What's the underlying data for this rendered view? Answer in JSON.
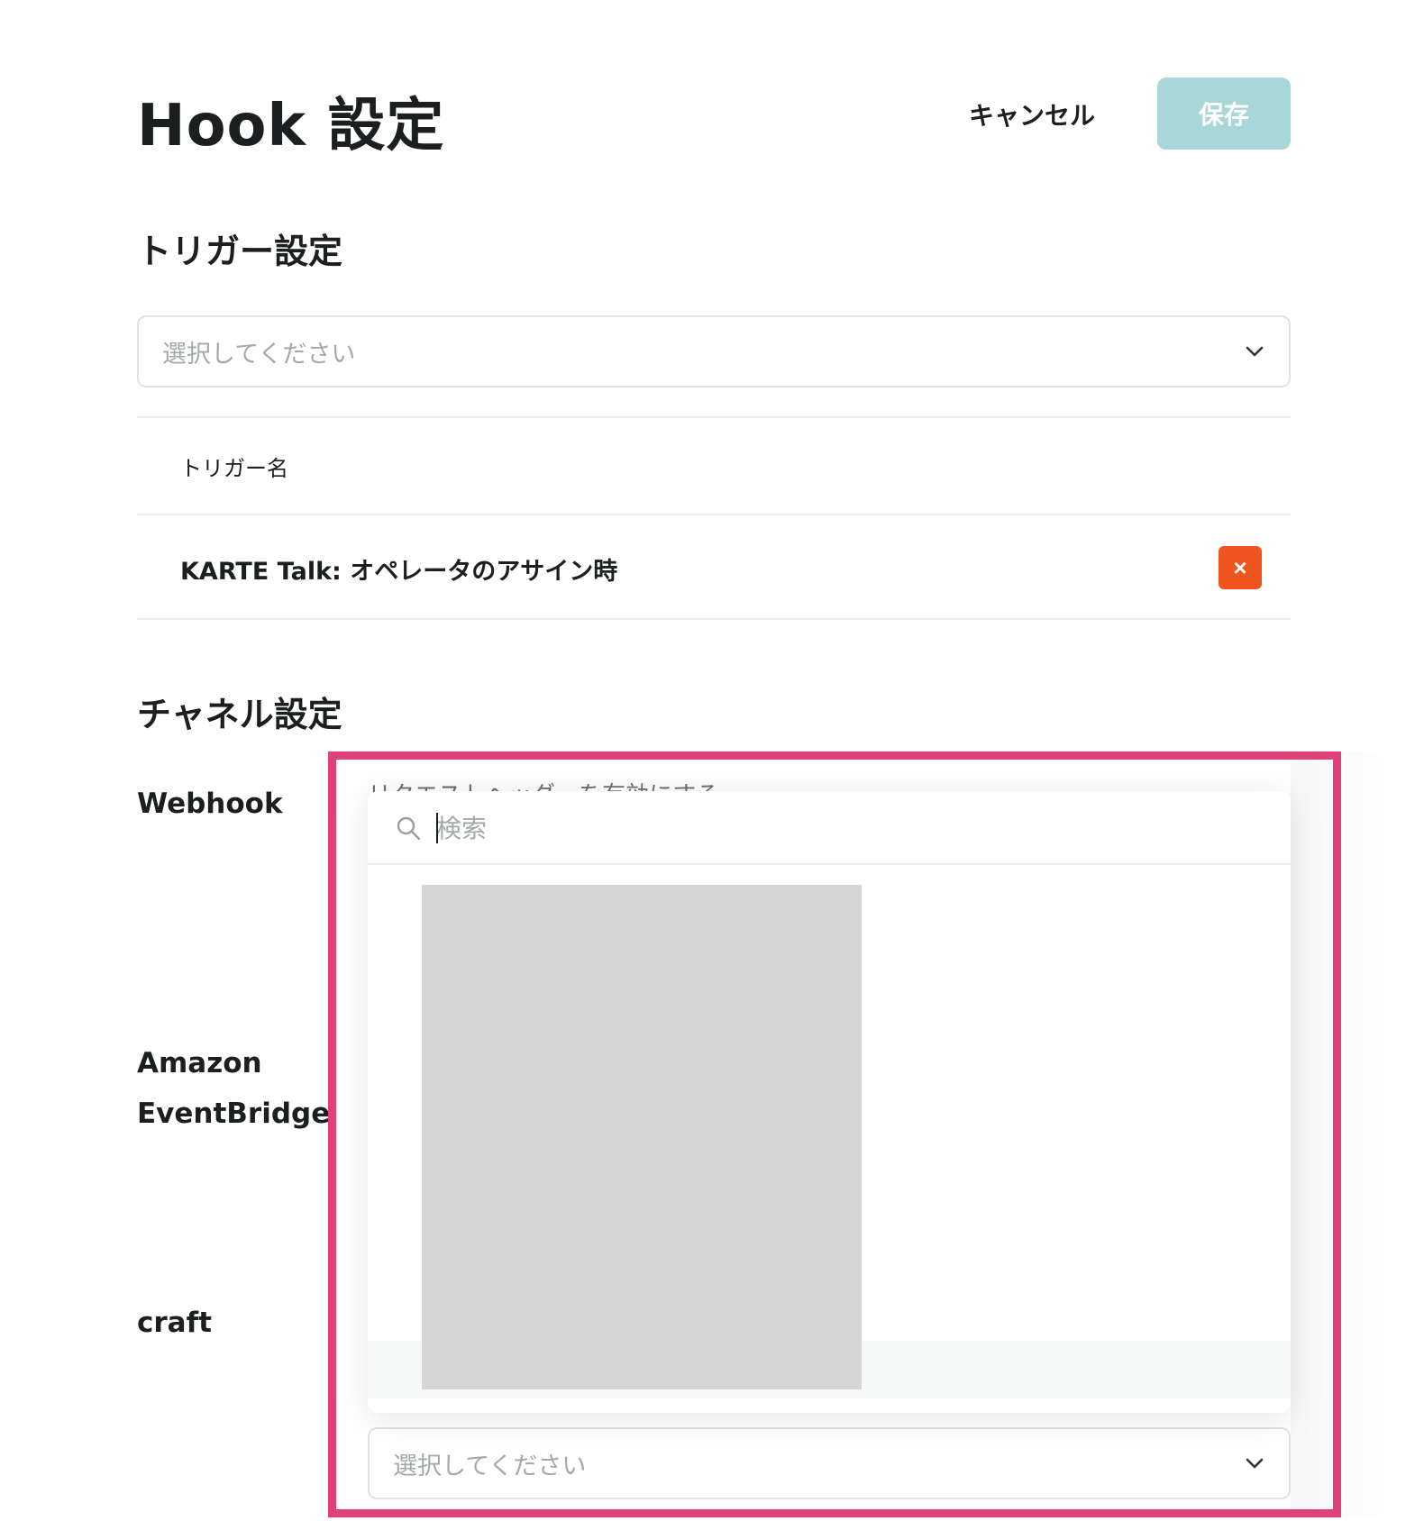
{
  "header": {
    "title": "Hook 設定",
    "cancel_label": "キャンセル",
    "save_label": "保存"
  },
  "trigger_section": {
    "title": "トリガー設定",
    "select_placeholder": "選択してください",
    "table_header": "トリガー名",
    "rows": [
      {
        "name": "KARTE Talk: オペレータのアサイン時",
        "remove_label": "×"
      }
    ]
  },
  "channel_section": {
    "title": "チャネル設定",
    "channels": [
      "Webhook",
      "Amazon",
      "EventBridge",
      "craft"
    ],
    "background_text": "リクエストヘッダーを有効にする",
    "dropdown": {
      "search_placeholder": "検索"
    },
    "bottom_select_placeholder": "選択してください"
  },
  "colors": {
    "save_button": "#a9d6d8",
    "remove_button": "#f0541f",
    "highlight": "#e0417a"
  }
}
